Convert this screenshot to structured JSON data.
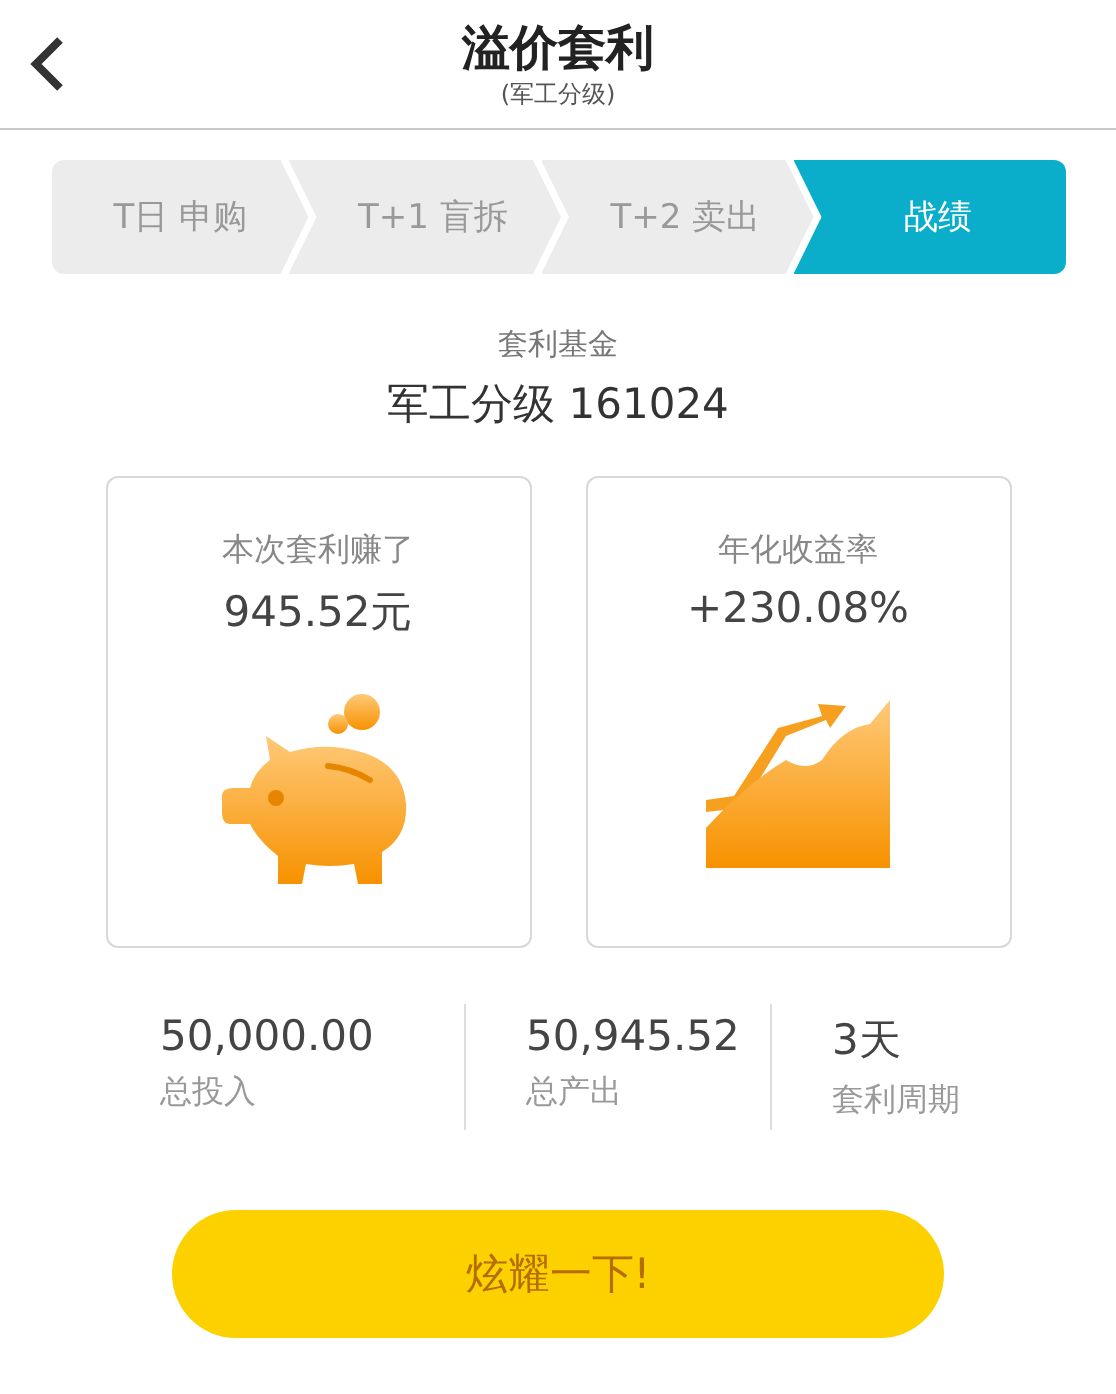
{
  "header": {
    "title": "溢价套利",
    "subtitle": "(军工分级)"
  },
  "steps": [
    {
      "label": "T日 申购",
      "selected": false
    },
    {
      "label": "T+1 盲拆",
      "selected": false
    },
    {
      "label": "T+2 卖出",
      "selected": false
    },
    {
      "label": "战绩",
      "selected": true
    }
  ],
  "fund": {
    "label": "套利基金",
    "name": "军工分级 161024"
  },
  "cards": [
    {
      "kind": "savings",
      "label": "本次套利赚了",
      "value": "945.52元"
    },
    {
      "kind": "growth",
      "label": "年化收益率",
      "value": "+230.08%"
    }
  ],
  "stats": [
    {
      "value": "50,000.00",
      "label": "总投入"
    },
    {
      "value": "50,945.52",
      "label": "总产出"
    },
    {
      "value": "3天",
      "label": "套利周期"
    }
  ],
  "share_button": {
    "label": "炫耀一下!"
  }
}
